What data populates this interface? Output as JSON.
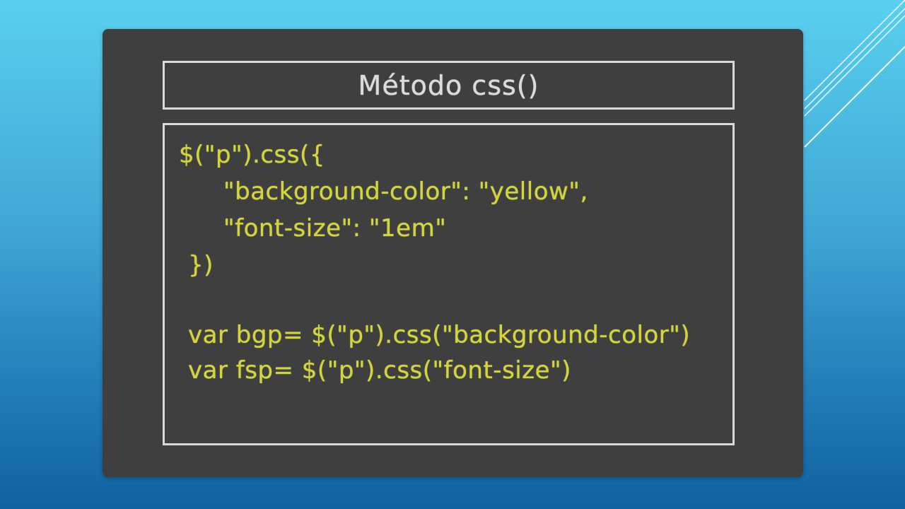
{
  "slide": {
    "title": "Método css()",
    "code_lines": [
      "$(\"p\").css({",
      "\"background-color\": \"yellow\",",
      "\"font-size\": \"1em\"",
      "})",
      "var bgp= $(\"p\").css(\"background-color\")",
      "var fsp= $(\"p\").css(\"font-size\")"
    ]
  },
  "colors": {
    "background_top": "#5ad0ee",
    "background_bottom": "#0f62a0",
    "board": "#3f3f3f",
    "frame": "#d9d9d9",
    "title_text": "#dcdcdc",
    "code_text": "#d4d53a"
  }
}
